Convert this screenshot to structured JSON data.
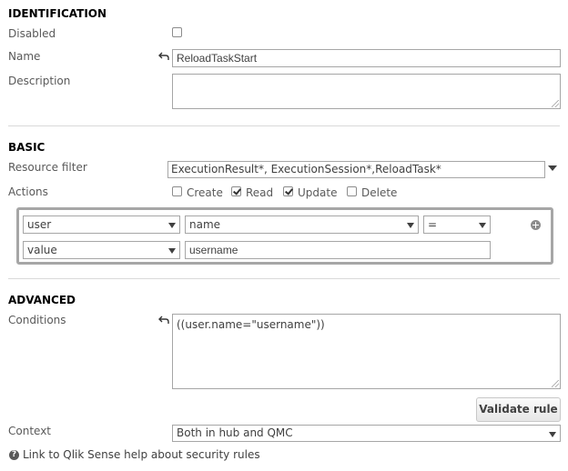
{
  "identification": {
    "heading": "IDENTIFICATION",
    "disabled_label": "Disabled",
    "name_label": "Name",
    "name_value": "ReloadTaskStart",
    "description_label": "Description",
    "description_value": ""
  },
  "basic": {
    "heading": "BASIC",
    "resource_filter_label": "Resource filter",
    "resource_filter_value": "ExecutionResult*, ExecutionSession*,ReloadTask*",
    "actions_label": "Actions",
    "actions": [
      {
        "label": "Create",
        "checked": false
      },
      {
        "label": "Read",
        "checked": true
      },
      {
        "label": "Update",
        "checked": true
      },
      {
        "label": "Delete",
        "checked": false
      }
    ],
    "rule_editor": {
      "row1": {
        "subject": "user",
        "property": "name",
        "operator": "="
      },
      "row2": {
        "type": "value",
        "value": "username"
      }
    }
  },
  "advanced": {
    "heading": "ADVANCED",
    "conditions_label": "Conditions",
    "conditions_value": "((user.name=\"username\"))",
    "validate_button": "Validate rule",
    "context_label": "Context",
    "context_value": "Both in hub and QMC"
  },
  "help_link": "Link to Qlik Sense help about security rules",
  "icons": {
    "undo": "undo-arrow-icon",
    "dropdown": "chevron-down-icon",
    "add": "plus-circle-icon",
    "help": "question-circle-icon"
  },
  "colors": {
    "border": "#a6a6a6",
    "text": "#595959",
    "heading": "#000000"
  }
}
